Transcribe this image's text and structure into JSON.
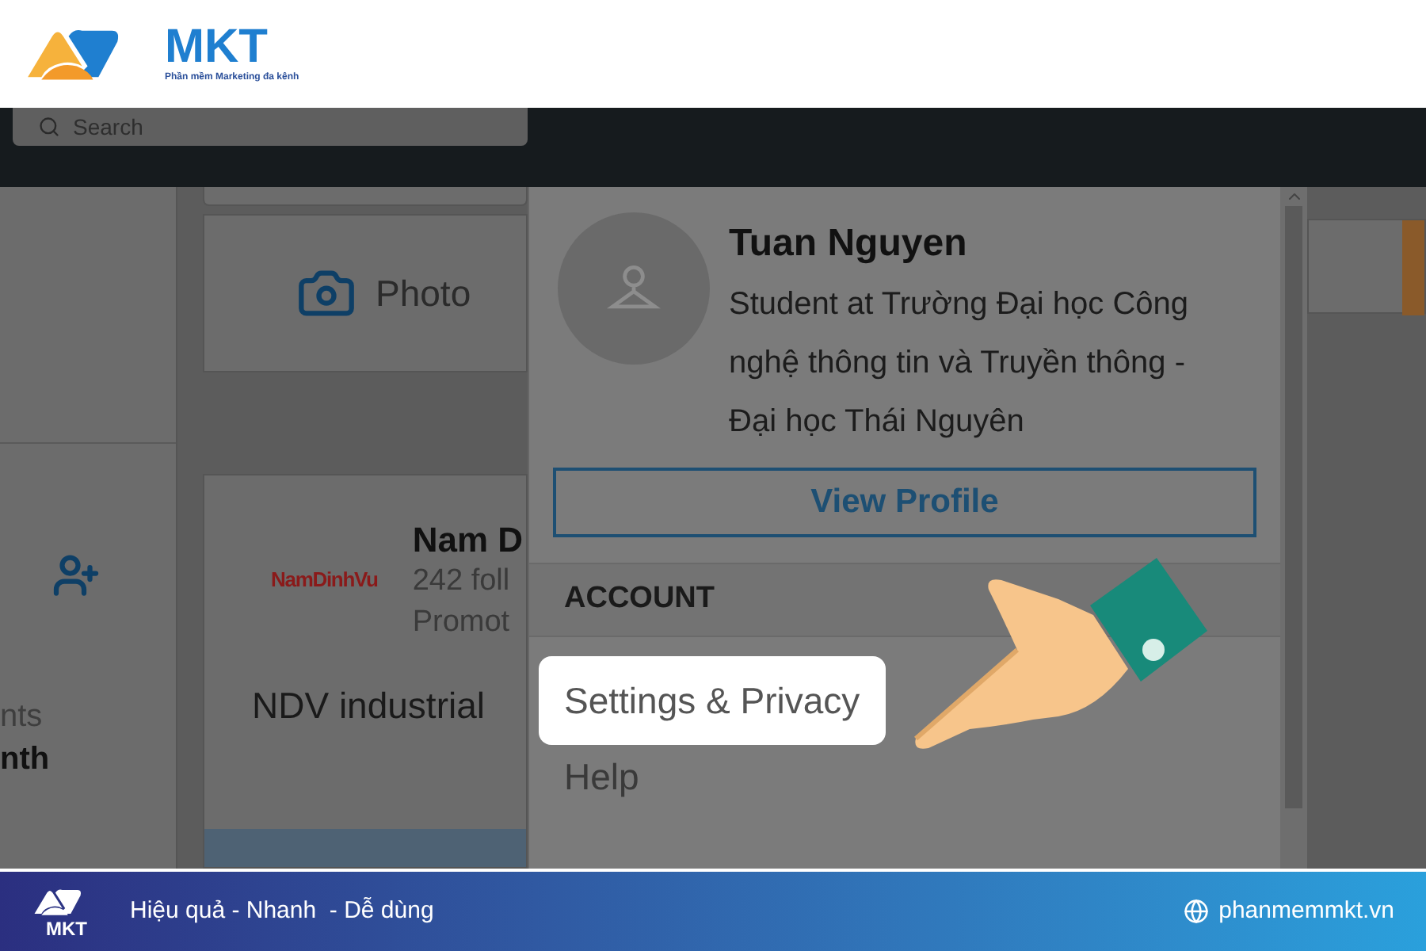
{
  "brand": {
    "name": "MKT",
    "tagline": "Phần mềm Marketing đa kênh"
  },
  "header": {
    "search": {
      "placeholder": "Search"
    }
  },
  "left_panel": {
    "texts": [
      "nts",
      "nth"
    ]
  },
  "feed": {
    "share_action": "Photo",
    "company_card": {
      "logo_text": "NamDinhVu",
      "name": "Nam D",
      "followers": "242 foll",
      "tag": "Promot",
      "description": "NDV industrial"
    }
  },
  "profile_menu": {
    "name": "Tuan Nguyen",
    "headline": "Student at Trường Đại học Công nghệ thông tin và Truyền thông - Đại học Thái Nguyên",
    "button": "View Profile",
    "section": "ACCOUNT",
    "items": [
      {
        "label": "Settings & Privacy",
        "selected": true
      },
      {
        "label": "Help",
        "selected": false
      }
    ]
  },
  "footer": {
    "brand": "MKT",
    "slogan": "Hiệu quả - Nhanh  - Dễ dùng",
    "website": "phanmemmkt.vn"
  }
}
